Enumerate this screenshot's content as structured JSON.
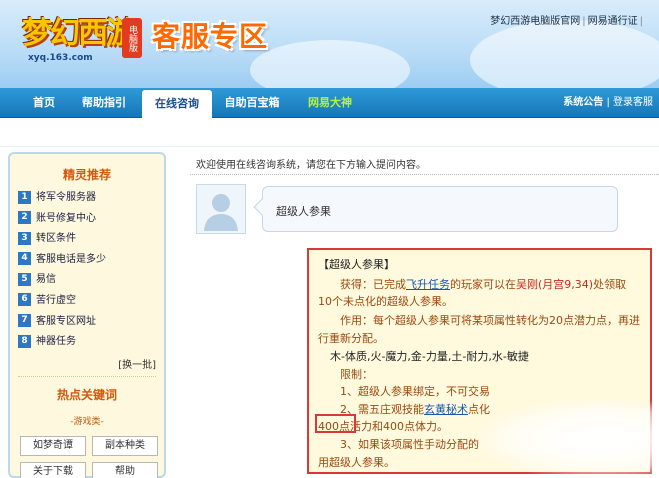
{
  "header": {
    "logo": "梦幻西游",
    "logo_badge": "电脑版",
    "logo_url": "xyq.163.com",
    "zone_title": "客服专区",
    "links": [
      "梦幻西游电脑版官网",
      "网易通行证"
    ]
  },
  "nav": {
    "items": [
      "首页",
      "帮助指引",
      "在线咨询",
      "自助百宝箱",
      "网易大神"
    ],
    "active": "在线咨询",
    "right": [
      "系统公告",
      "登录客服"
    ]
  },
  "sidebar": {
    "title": "精灵推荐",
    "items": [
      {
        "num": "1",
        "label": "将军令服务器"
      },
      {
        "num": "2",
        "label": "账号修复中心"
      },
      {
        "num": "3",
        "label": "转区条件"
      },
      {
        "num": "4",
        "label": "客服电话是多少"
      },
      {
        "num": "5",
        "label": "易信"
      },
      {
        "num": "6",
        "label": "苦行虚空"
      },
      {
        "num": "7",
        "label": "客服专区网址"
      },
      {
        "num": "8",
        "label": "神器任务"
      }
    ],
    "swap": "[换一批]",
    "hot_title": "热点关键词",
    "hot_category": "-游戏类-",
    "tags": [
      "如梦奇谭",
      "副本种类",
      "关于下载",
      "帮助"
    ]
  },
  "main": {
    "welcome": "欢迎使用在线咨询系统，请您在下方输入提问内容。",
    "question": "超级人参果",
    "answer": {
      "title": "【超级人参果】",
      "obtain_1": "获得：已完成",
      "obtain_link": "飞升任务",
      "obtain_2": "的玩家可以在",
      "obtain_loc": "吴刚(月宫9,34)",
      "obtain_3": "处领取",
      "obtain_line2": "10个未点化的超级人参果。",
      "use_line1": "作用：每个超级人参果可将某项属性转化为20点潜力点，再进",
      "use_line2": "行重新分配。",
      "attrs": "木-体质,火-魔力,金-力量,土-耐力,水-敏捷",
      "limit_title": "限制：",
      "limit_1": "1、超级人参果绑定，不可交易",
      "limit_2a": "2、需五庄观技能",
      "limit_2_link": "玄黄秘术",
      "limit_2b": "点化",
      "limit_2c": "400点活力",
      "limit_2d": "和400点体力。",
      "limit_3": "3、如果该项属性手动分配的",
      "limit_3b": "用超级人参果。"
    }
  },
  "colors": {
    "nav_blue": "#1676b7",
    "accent_orange": "#ff6a00",
    "highlight_red": "#d8383a",
    "answer_bg": "#fff9dd"
  }
}
